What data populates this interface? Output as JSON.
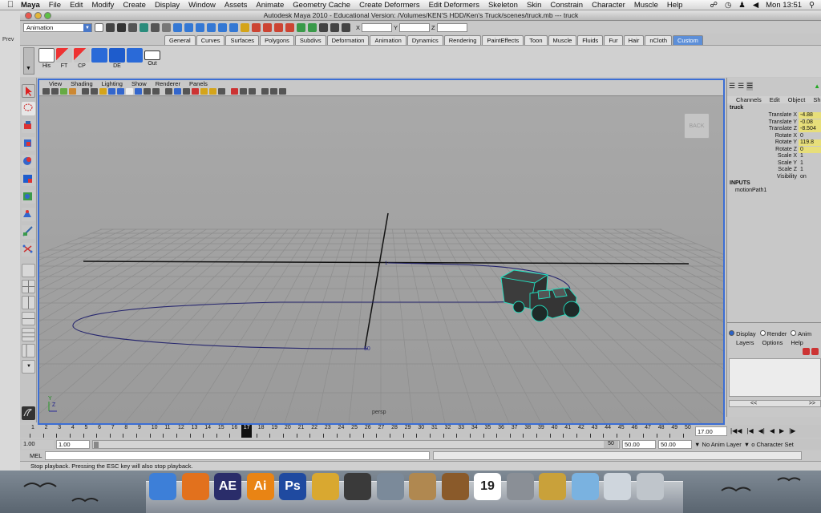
{
  "menubar": {
    "app": "Maya",
    "items": [
      "File",
      "Edit",
      "Modify",
      "Create",
      "Display",
      "Window",
      "Assets",
      "Animate",
      "Geometry Cache",
      "Create Deformers",
      "Edit Deformers",
      "Skeleton",
      "Skin",
      "Constrain",
      "Character",
      "Muscle",
      "Help"
    ],
    "clock": "Mon 13:51"
  },
  "window": {
    "title": "Autodesk Maya 2010 - Educational Version: /Volumes/KEN'S HDD/Ken's Truck/scenes/truck.mb  ---  truck"
  },
  "statusline": {
    "mode": "Animation",
    "x_label": "X",
    "y_label": "Y",
    "z_label": "Z"
  },
  "shelf_tabs": [
    "General",
    "Curves",
    "Surfaces",
    "Polygons",
    "Subdivs",
    "Deformation",
    "Animation",
    "Dynamics",
    "Rendering",
    "PaintEffects",
    "Toon",
    "Muscle",
    "Fluids",
    "Fur",
    "Hair",
    "nCloth",
    "Custom"
  ],
  "shelf_tabs_active": "Custom",
  "shelf_buttons": [
    "His",
    "FT",
    "CP",
    "",
    "DE",
    "",
    "Out"
  ],
  "left_edge_label": "Prev",
  "panel": {
    "menu": [
      "View",
      "Shading",
      "Lighting",
      "Show",
      "Renderer",
      "Panels"
    ],
    "viewcube": "BACK",
    "camera": "persp",
    "axis_y": "Y",
    "axis_z": "Z"
  },
  "channelbox": {
    "tabs": [
      "Channels",
      "Edit",
      "Object",
      "Sh"
    ],
    "object": "truck",
    "attributes": [
      {
        "name": "Translate X",
        "value": "-4.88",
        "keyed": true
      },
      {
        "name": "Translate Y",
        "value": "-0.08",
        "keyed": true
      },
      {
        "name": "Translate Z",
        "value": "-8.504",
        "keyed": true
      },
      {
        "name": "Rotate X",
        "value": "0",
        "keyed": false
      },
      {
        "name": "Rotate Y",
        "value": "119.8",
        "keyed": true
      },
      {
        "name": "Rotate Z",
        "value": "0",
        "keyed": true
      },
      {
        "name": "Scale X",
        "value": "1",
        "keyed": false
      },
      {
        "name": "Scale Y",
        "value": "1",
        "keyed": false
      },
      {
        "name": "Scale Z",
        "value": "1",
        "keyed": false
      },
      {
        "name": "Visibility",
        "value": "on",
        "keyed": false
      }
    ],
    "inputs_header": "INPUTS",
    "inputs": [
      "motionPath1"
    ]
  },
  "layers": {
    "radios": [
      "Display",
      "Render",
      "Anim"
    ],
    "selected": "Display",
    "menu": [
      "Layers",
      "Options",
      "Help"
    ],
    "scroll_left": "<<",
    "scroll_right": ">>"
  },
  "timeslider": {
    "start": 1,
    "end": 50,
    "current": 17,
    "current_field": "17.00"
  },
  "rangeslider": {
    "start": "1.00",
    "playback_start": "1.00",
    "range_end_label": "50",
    "playback_end": "50.00",
    "end": "50.00",
    "anim_layer": "No Anim Layer",
    "character_set": "o Character Set"
  },
  "mel": {
    "label": "MEL"
  },
  "helpline": "Stop playback.  Pressing the ESC key will also stop playback.",
  "dock": [
    {
      "name": "finder",
      "label": "",
      "color": "#3d7fd8"
    },
    {
      "name": "firefox",
      "label": "",
      "color": "#e2711d"
    },
    {
      "name": "after-effects",
      "label": "AE",
      "color": "#2a2d6a"
    },
    {
      "name": "illustrator",
      "label": "Ai",
      "color": "#e98414"
    },
    {
      "name": "photoshop",
      "label": "Ps",
      "color": "#1f4aa0"
    },
    {
      "name": "pencil-app",
      "label": "",
      "color": "#d9a830"
    },
    {
      "name": "maya",
      "label": "",
      "color": "#3a3a3a"
    },
    {
      "name": "preview",
      "label": "",
      "color": "#7b8a9a"
    },
    {
      "name": "photo-booth",
      "label": "",
      "color": "#b08850"
    },
    {
      "name": "garageband",
      "label": "",
      "color": "#8a5a2a"
    },
    {
      "name": "ical",
      "label": "19",
      "color": "#ffffff"
    },
    {
      "name": "system-preferences",
      "label": "",
      "color": "#8a8f96"
    },
    {
      "name": "keychain",
      "label": "",
      "color": "#c9a13a"
    },
    {
      "name": "downloads-folder",
      "label": "",
      "color": "#7ab2e0"
    },
    {
      "name": "documents",
      "label": "",
      "color": "#cfd6dd"
    },
    {
      "name": "trash",
      "label": "",
      "color": "#bfc5cb"
    }
  ],
  "colors": {
    "accent": "#3c6ed4",
    "keyed": "#e7de7a",
    "truck": "#22e0c0",
    "path": "#26266e"
  }
}
